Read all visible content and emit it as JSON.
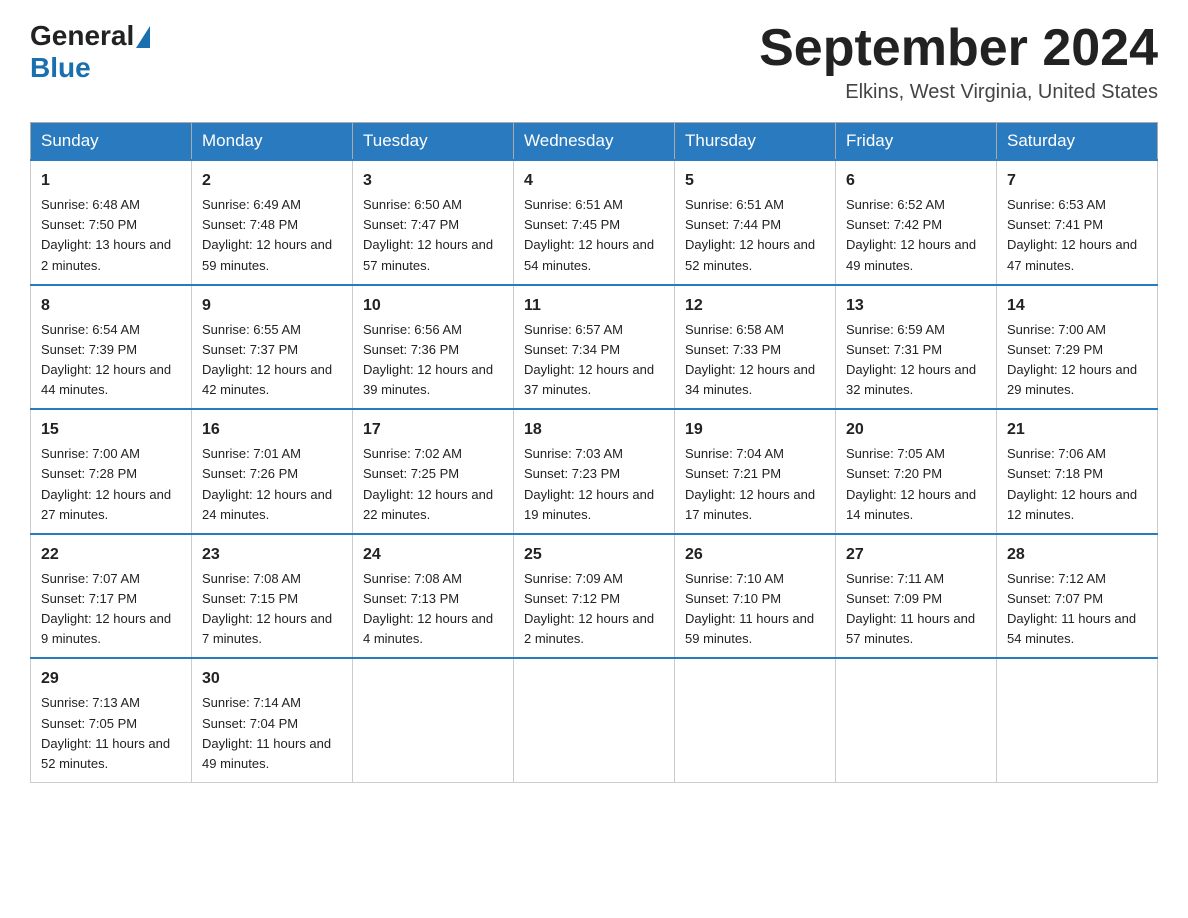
{
  "logo": {
    "text_general": "General",
    "text_blue": "Blue"
  },
  "title": {
    "month_year": "September 2024",
    "location": "Elkins, West Virginia, United States"
  },
  "weekdays": [
    "Sunday",
    "Monday",
    "Tuesday",
    "Wednesday",
    "Thursday",
    "Friday",
    "Saturday"
  ],
  "weeks": [
    [
      {
        "day": "1",
        "sunrise": "6:48 AM",
        "sunset": "7:50 PM",
        "daylight": "13 hours and 2 minutes."
      },
      {
        "day": "2",
        "sunrise": "6:49 AM",
        "sunset": "7:48 PM",
        "daylight": "12 hours and 59 minutes."
      },
      {
        "day": "3",
        "sunrise": "6:50 AM",
        "sunset": "7:47 PM",
        "daylight": "12 hours and 57 minutes."
      },
      {
        "day": "4",
        "sunrise": "6:51 AM",
        "sunset": "7:45 PM",
        "daylight": "12 hours and 54 minutes."
      },
      {
        "day": "5",
        "sunrise": "6:51 AM",
        "sunset": "7:44 PM",
        "daylight": "12 hours and 52 minutes."
      },
      {
        "day": "6",
        "sunrise": "6:52 AM",
        "sunset": "7:42 PM",
        "daylight": "12 hours and 49 minutes."
      },
      {
        "day": "7",
        "sunrise": "6:53 AM",
        "sunset": "7:41 PM",
        "daylight": "12 hours and 47 minutes."
      }
    ],
    [
      {
        "day": "8",
        "sunrise": "6:54 AM",
        "sunset": "7:39 PM",
        "daylight": "12 hours and 44 minutes."
      },
      {
        "day": "9",
        "sunrise": "6:55 AM",
        "sunset": "7:37 PM",
        "daylight": "12 hours and 42 minutes."
      },
      {
        "day": "10",
        "sunrise": "6:56 AM",
        "sunset": "7:36 PM",
        "daylight": "12 hours and 39 minutes."
      },
      {
        "day": "11",
        "sunrise": "6:57 AM",
        "sunset": "7:34 PM",
        "daylight": "12 hours and 37 minutes."
      },
      {
        "day": "12",
        "sunrise": "6:58 AM",
        "sunset": "7:33 PM",
        "daylight": "12 hours and 34 minutes."
      },
      {
        "day": "13",
        "sunrise": "6:59 AM",
        "sunset": "7:31 PM",
        "daylight": "12 hours and 32 minutes."
      },
      {
        "day": "14",
        "sunrise": "7:00 AM",
        "sunset": "7:29 PM",
        "daylight": "12 hours and 29 minutes."
      }
    ],
    [
      {
        "day": "15",
        "sunrise": "7:00 AM",
        "sunset": "7:28 PM",
        "daylight": "12 hours and 27 minutes."
      },
      {
        "day": "16",
        "sunrise": "7:01 AM",
        "sunset": "7:26 PM",
        "daylight": "12 hours and 24 minutes."
      },
      {
        "day": "17",
        "sunrise": "7:02 AM",
        "sunset": "7:25 PM",
        "daylight": "12 hours and 22 minutes."
      },
      {
        "day": "18",
        "sunrise": "7:03 AM",
        "sunset": "7:23 PM",
        "daylight": "12 hours and 19 minutes."
      },
      {
        "day": "19",
        "sunrise": "7:04 AM",
        "sunset": "7:21 PM",
        "daylight": "12 hours and 17 minutes."
      },
      {
        "day": "20",
        "sunrise": "7:05 AM",
        "sunset": "7:20 PM",
        "daylight": "12 hours and 14 minutes."
      },
      {
        "day": "21",
        "sunrise": "7:06 AM",
        "sunset": "7:18 PM",
        "daylight": "12 hours and 12 minutes."
      }
    ],
    [
      {
        "day": "22",
        "sunrise": "7:07 AM",
        "sunset": "7:17 PM",
        "daylight": "12 hours and 9 minutes."
      },
      {
        "day": "23",
        "sunrise": "7:08 AM",
        "sunset": "7:15 PM",
        "daylight": "12 hours and 7 minutes."
      },
      {
        "day": "24",
        "sunrise": "7:08 AM",
        "sunset": "7:13 PM",
        "daylight": "12 hours and 4 minutes."
      },
      {
        "day": "25",
        "sunrise": "7:09 AM",
        "sunset": "7:12 PM",
        "daylight": "12 hours and 2 minutes."
      },
      {
        "day": "26",
        "sunrise": "7:10 AM",
        "sunset": "7:10 PM",
        "daylight": "11 hours and 59 minutes."
      },
      {
        "day": "27",
        "sunrise": "7:11 AM",
        "sunset": "7:09 PM",
        "daylight": "11 hours and 57 minutes."
      },
      {
        "day": "28",
        "sunrise": "7:12 AM",
        "sunset": "7:07 PM",
        "daylight": "11 hours and 54 minutes."
      }
    ],
    [
      {
        "day": "29",
        "sunrise": "7:13 AM",
        "sunset": "7:05 PM",
        "daylight": "11 hours and 52 minutes."
      },
      {
        "day": "30",
        "sunrise": "7:14 AM",
        "sunset": "7:04 PM",
        "daylight": "11 hours and 49 minutes."
      },
      null,
      null,
      null,
      null,
      null
    ]
  ]
}
